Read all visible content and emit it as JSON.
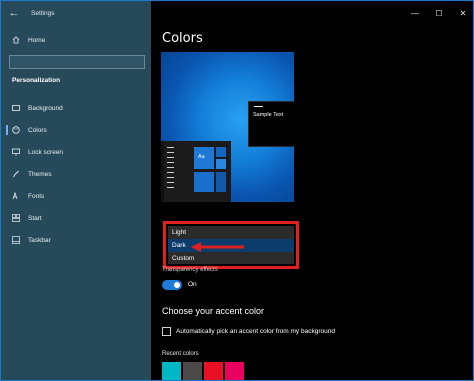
{
  "app": {
    "title": "Settings"
  },
  "window_controls": {
    "minimize": "—",
    "maximize": "☐",
    "close": "✕"
  },
  "sidebar": {
    "home_label": "Home",
    "section_title": "Personalization",
    "items": [
      {
        "label": "Background",
        "icon": "picture-icon"
      },
      {
        "label": "Colors",
        "icon": "palette-icon",
        "active": true
      },
      {
        "label": "Lock screen",
        "icon": "monitor-lock-icon"
      },
      {
        "label": "Themes",
        "icon": "brush-icon"
      },
      {
        "label": "Fonts",
        "icon": "font-icon"
      },
      {
        "label": "Start",
        "icon": "start-icon"
      },
      {
        "label": "Taskbar",
        "icon": "taskbar-icon"
      }
    ]
  },
  "main": {
    "title": "Colors",
    "preview": {
      "sample_text": "Sample Text",
      "tile_text": "Aa"
    },
    "mode_dropdown": {
      "options": [
        "Light",
        "Dark",
        "Custom"
      ],
      "selected": "Dark"
    },
    "transparency": {
      "label": "Transparency effects",
      "state": "On"
    },
    "accent": {
      "title": "Choose your accent color",
      "auto_pick_label": "Automatically pick an accent color from my background",
      "recent_label": "Recent colors",
      "recent_colors": [
        "#00b7c3",
        "#4c4a48",
        "#e81123",
        "#ea005e"
      ]
    }
  },
  "colors": {
    "highlight": "#e0201f",
    "sidebar_bg": "#274a5a",
    "accent": "#1f7ad8"
  }
}
